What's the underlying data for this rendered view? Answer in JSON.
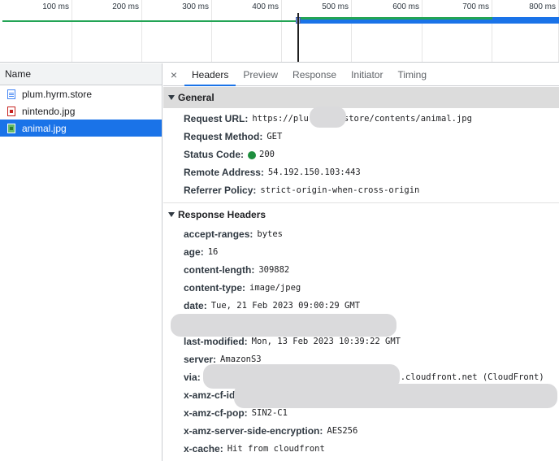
{
  "timeline": {
    "ticks": [
      "100 ms",
      "200 ms",
      "300 ms",
      "400 ms",
      "500 ms",
      "600 ms",
      "700 ms",
      "800 ms"
    ]
  },
  "requests_panel": {
    "column_header": "Name",
    "items": [
      {
        "name": "plum.hyrm.store",
        "icon": "document-icon"
      },
      {
        "name": "nintendo.jpg",
        "icon": "image-icon"
      },
      {
        "name": "animal.jpg",
        "icon": "image-icon",
        "selected": true
      }
    ]
  },
  "details": {
    "close_glyph": "×",
    "tabs": [
      "Headers",
      "Preview",
      "Response",
      "Initiator",
      "Timing"
    ],
    "active_tab": "Headers",
    "general": {
      "title": "General",
      "rows": [
        {
          "key": "Request URL",
          "value_prefix": "https://plu",
          "value_suffix": "store/contents/animal.jpg"
        },
        {
          "key": "Request Method",
          "value": "GET"
        },
        {
          "key": "Status Code",
          "value": "200"
        },
        {
          "key": "Remote Address",
          "value": "54.192.150.103:443"
        },
        {
          "key": "Referrer Policy",
          "value": "strict-origin-when-cross-origin"
        }
      ]
    },
    "response_headers": {
      "title": "Response Headers",
      "rows": [
        {
          "key": "accept-ranges",
          "value": "bytes"
        },
        {
          "key": "age",
          "value": "16"
        },
        {
          "key": "content-length",
          "value": "309882"
        },
        {
          "key": "content-type",
          "value": "image/jpeg"
        },
        {
          "key": "date",
          "value": "Tue, 21 Feb 2023 09:00:29 GMT"
        },
        {
          "key": "last-modified",
          "value": "Mon, 13 Feb 2023 10:39:22 GMT"
        },
        {
          "key": "server",
          "value": "AmazonS3"
        },
        {
          "key": "via",
          "value": ".cloudfront.net (CloudFront)"
        },
        {
          "key": "x-amz-cf-id",
          "value": ""
        },
        {
          "key": "x-amz-cf-pop",
          "value": "SIN2-C1"
        },
        {
          "key": "x-amz-server-side-encryption",
          "value": "AES256"
        },
        {
          "key": "x-cache",
          "value": "Hit from cloudfront"
        }
      ]
    }
  },
  "colors": {
    "selection": "#1a73e8",
    "status_ok": "#1e8e3e",
    "waterfall_green": "#23a455",
    "redaction": "#dadadc"
  }
}
